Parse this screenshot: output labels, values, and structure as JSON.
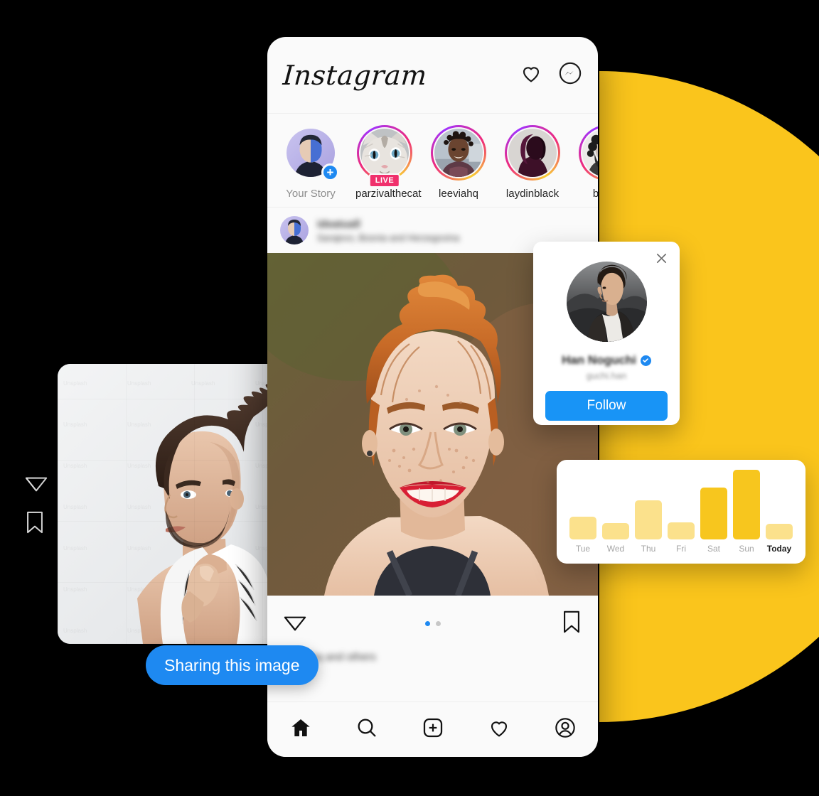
{
  "app": {
    "logo_text": "Instagram",
    "header_icons": [
      "heart-icon",
      "messenger-icon"
    ]
  },
  "stories": [
    {
      "name": "Your Story",
      "badge": "+",
      "ring": "none",
      "muted": true
    },
    {
      "name": "parzivalthecat",
      "badge": "LIVE",
      "ring": "gradient",
      "muted": false
    },
    {
      "name": "leeviahq",
      "badge": "",
      "ring": "gradient",
      "muted": false
    },
    {
      "name": "laydinblack",
      "badge": "",
      "ring": "gradient",
      "muted": false
    },
    {
      "name": "beard",
      "badge": "",
      "ring": "gradient",
      "muted": false
    }
  ],
  "post": {
    "username": "ideatuall",
    "location": "Sarajevo, Bosnia and Herzegovina",
    "caption": "leeviahq and others",
    "dots_total": 2,
    "dots_active_index": 0,
    "actions": [
      "send-icon",
      "bookmark-icon"
    ]
  },
  "bottom_nav": [
    "home-icon",
    "search-icon",
    "add-post-icon",
    "activity-icon",
    "profile-icon"
  ],
  "profile_card": {
    "name": "Han Noguchi",
    "handle": "guchi.han",
    "verified": true,
    "follow_label": "Follow",
    "close_label": "×"
  },
  "share_tooltip": {
    "label": "Sharing this image"
  },
  "float_icons": [
    "send-icon",
    "bookmark-icon"
  ],
  "colors": {
    "accent_blue": "#1E89F1",
    "follow_blue": "#1894F6",
    "backdrop_yellow": "#FAC51C",
    "bar_active": "#F7C61E",
    "bar_inactive": "#FBE18C",
    "live_pink": "#F0306C"
  },
  "chart_data": {
    "type": "bar",
    "title": "",
    "categories": [
      "Tue",
      "Wed",
      "Thu",
      "Fri",
      "Sat",
      "Sun",
      "Today"
    ],
    "values": [
      32,
      23,
      55,
      24,
      73,
      98,
      22
    ],
    "highlight": [
      "Sat",
      "Sun"
    ],
    "bold_label": "Today",
    "xlabel": "",
    "ylabel": "",
    "ylim": [
      0,
      100
    ],
    "grid": false,
    "legend": "none"
  }
}
